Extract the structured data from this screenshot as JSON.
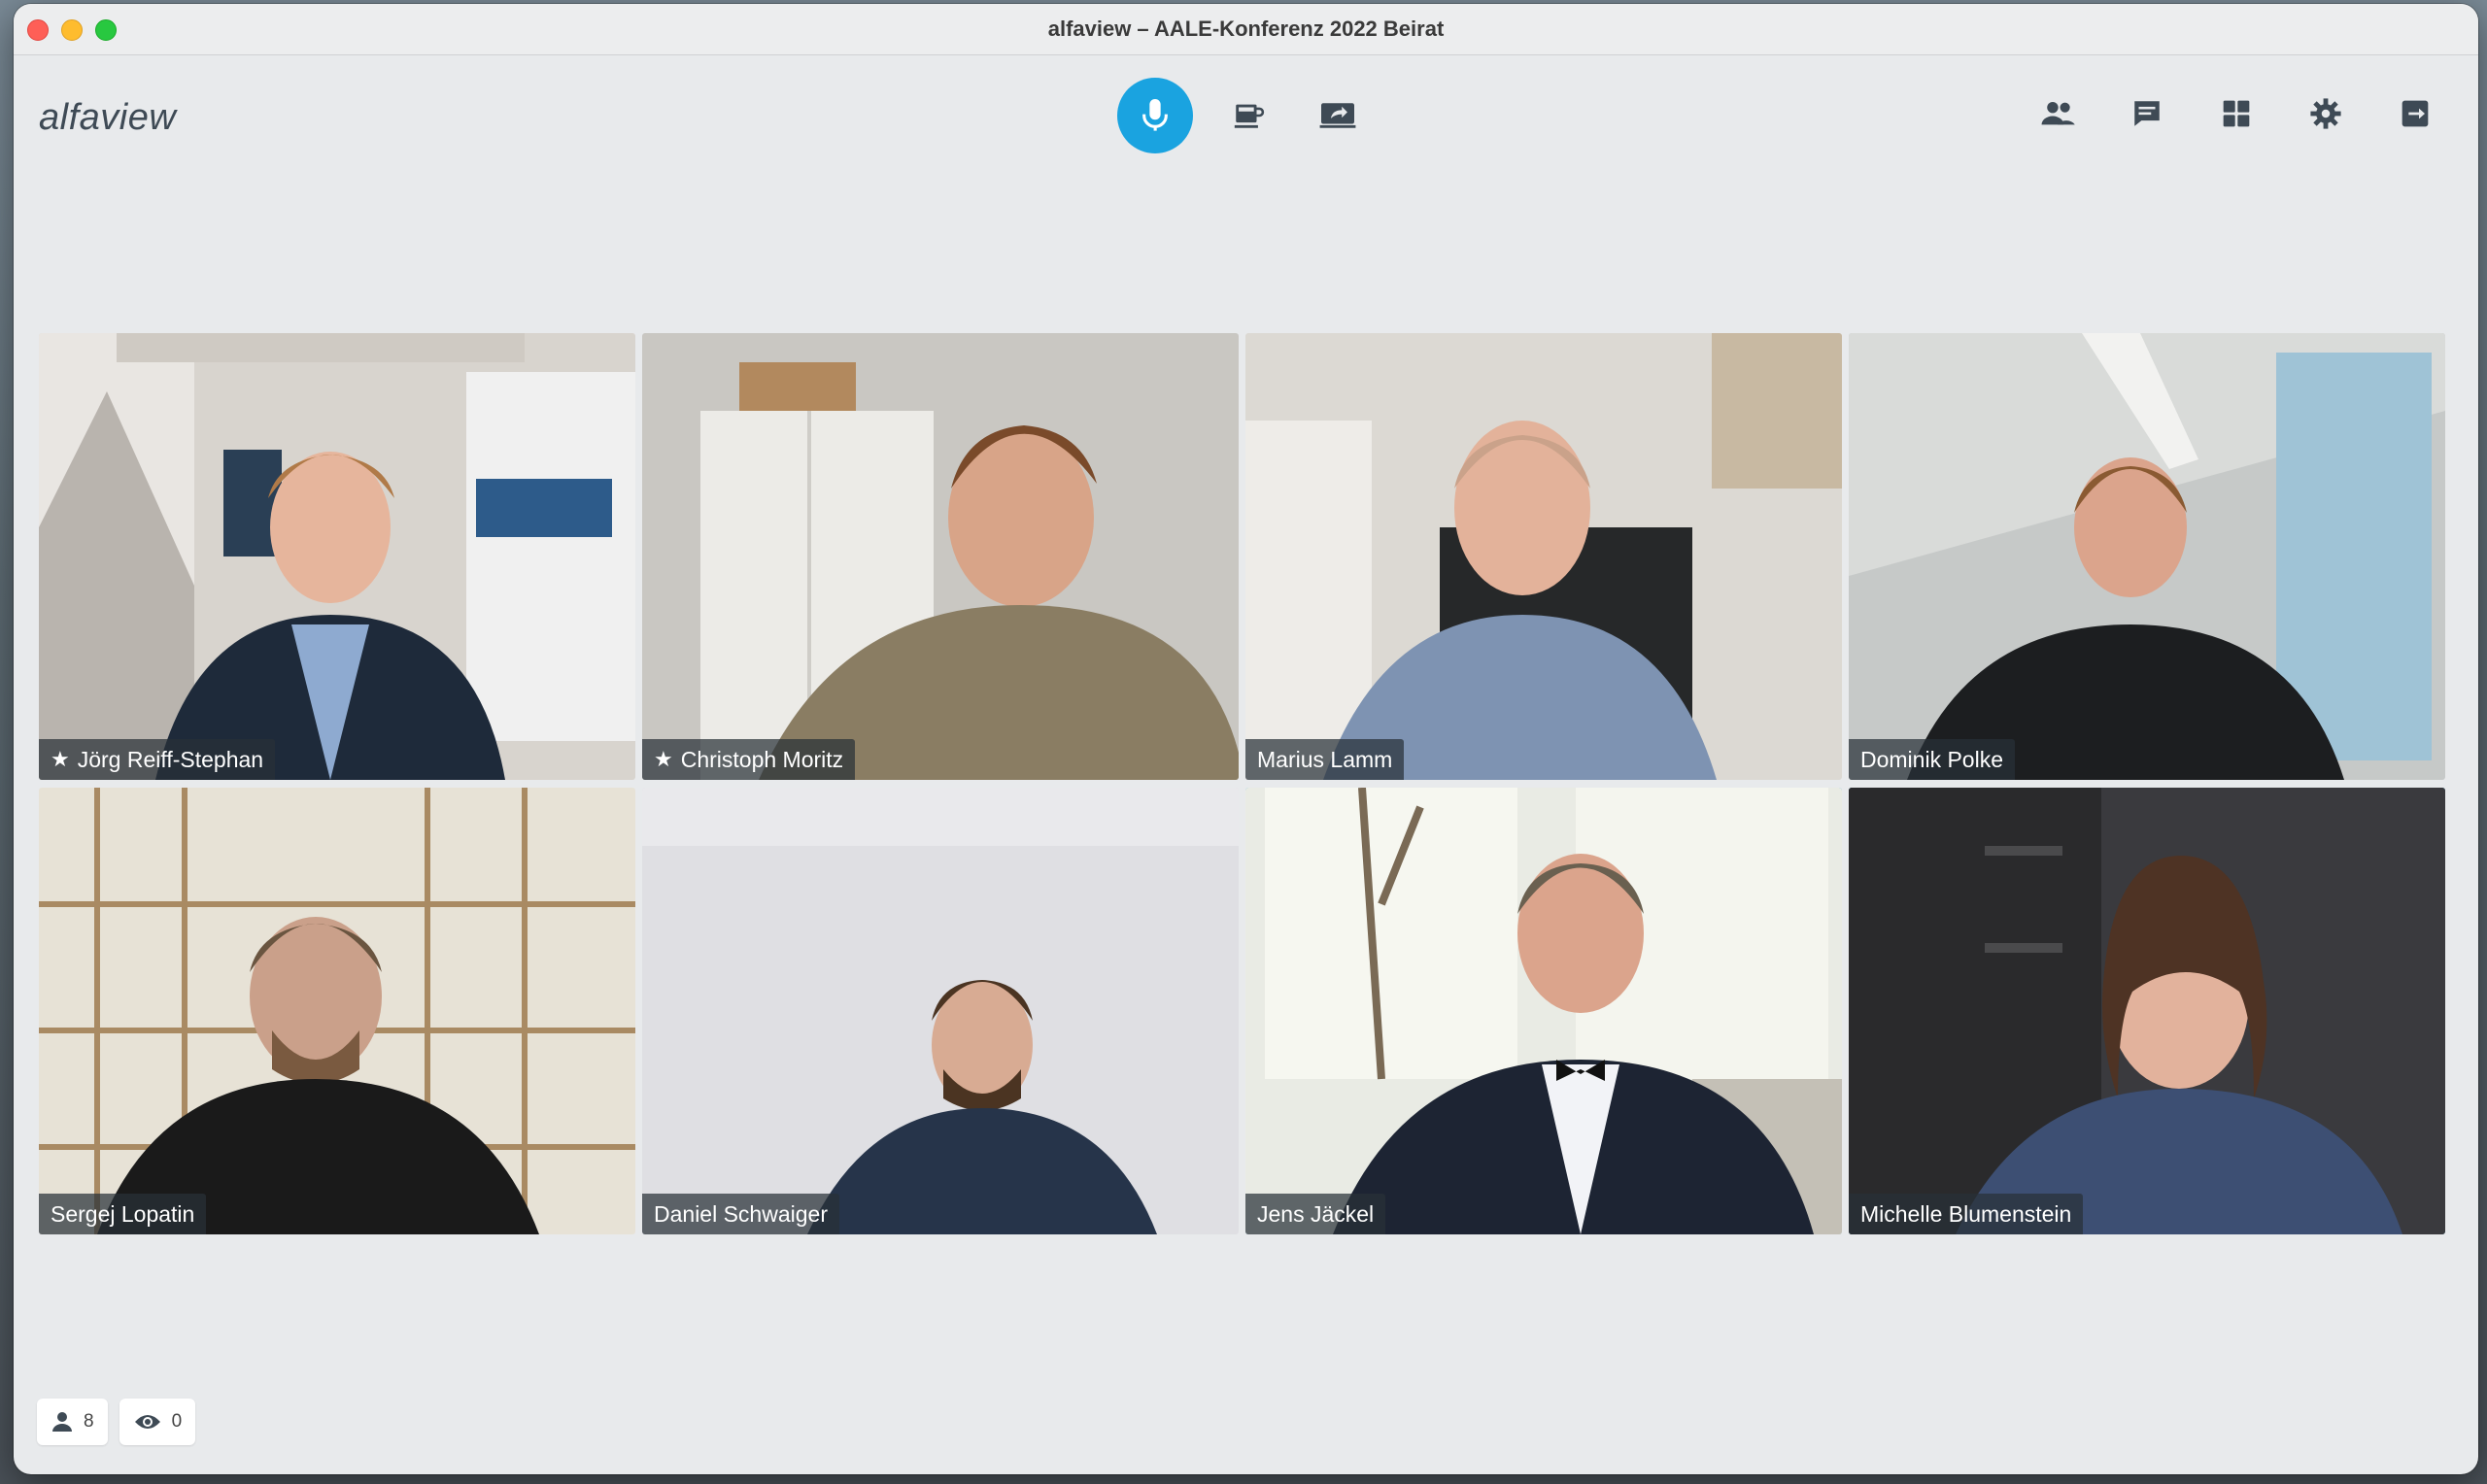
{
  "window": {
    "title": "alfaview – AALE-Konferenz 2022 Beirat"
  },
  "app": {
    "logo": "alfaview"
  },
  "toolbar": {
    "center": [
      {
        "icon": "microphone-icon",
        "active": true,
        "color": "#1aa3e0"
      },
      {
        "icon": "coffee-break-icon"
      },
      {
        "icon": "screen-share-icon"
      }
    ],
    "right": [
      {
        "icon": "participants-icon"
      },
      {
        "icon": "chat-icon"
      },
      {
        "icon": "layout-grid-icon"
      },
      {
        "icon": "settings-gear-icon"
      },
      {
        "icon": "leave-room-icon"
      }
    ]
  },
  "participants": [
    {
      "name": "Jörg Reiff-Stephan",
      "moderator": true
    },
    {
      "name": "Christoph Moritz",
      "moderator": true
    },
    {
      "name": "Marius Lamm",
      "moderator": false
    },
    {
      "name": "Dominik Polke",
      "moderator": false
    },
    {
      "name": "Sergej Lopatin",
      "moderator": false
    },
    {
      "name": "Daniel Schwaiger",
      "moderator": false
    },
    {
      "name": "Jens Jäckel",
      "moderator": false,
      "active": true
    },
    {
      "name": "Michelle Blumenstein",
      "moderator": false,
      "active": true
    }
  ],
  "status": {
    "participants_count": "8",
    "viewers_count": "0"
  },
  "colors": {
    "accent": "#1aa3e0",
    "active_border": "#3aa6d8"
  }
}
